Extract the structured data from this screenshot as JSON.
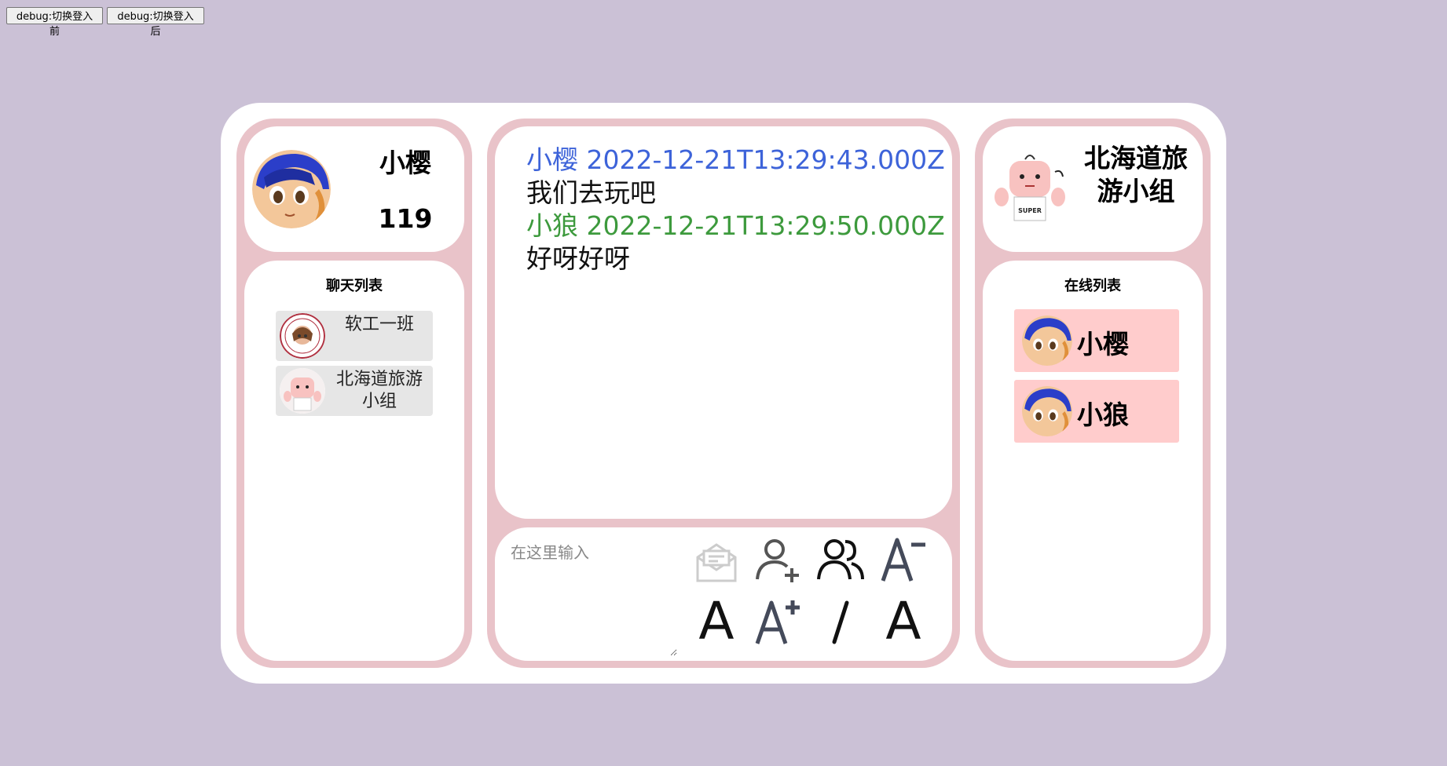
{
  "debug": {
    "before_label": "debug:切换登入前",
    "after_label": "debug:切换登入后"
  },
  "profile": {
    "name": "小樱",
    "count": "119"
  },
  "chat_list": {
    "title": "聊天列表",
    "items": [
      {
        "name": "软工一班"
      },
      {
        "name": "北海道旅游小组"
      }
    ]
  },
  "messages": [
    {
      "sender": "小樱",
      "time": "2022-12-21T13:29:43.000Z",
      "text": "我们去玩吧",
      "color": "#3d63d9"
    },
    {
      "sender": "小狼",
      "time": "2022-12-21T13:29:50.000Z",
      "text": "好呀好呀",
      "color": "#3d9a3d"
    }
  ],
  "composer": {
    "placeholder": "在这里输入",
    "tools": [
      "envelope-icon",
      "add-user-icon",
      "group-icon",
      "font-decrease-icon",
      "font-normal-icon",
      "font-increase-icon",
      "italic-icon",
      "font-reset-icon"
    ],
    "font_normal": "A",
    "font_reset": "A",
    "italic": "I"
  },
  "group": {
    "name": "北海道旅游小组"
  },
  "online_list": {
    "title": "在线列表",
    "items": [
      {
        "name": "小樱"
      },
      {
        "name": "小狼"
      }
    ]
  },
  "colors": {
    "background": "#cbc1d6",
    "panel_border": "#e9c3c9",
    "online_item": "#ffcccc",
    "chat_item": "#e6e6e6"
  }
}
